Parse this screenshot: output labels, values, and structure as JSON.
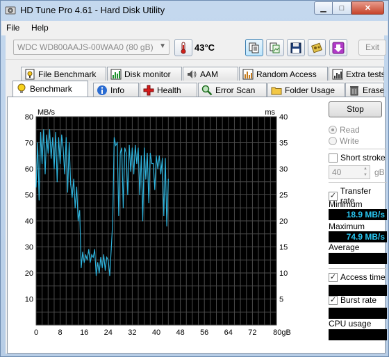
{
  "window": {
    "title": "HD Tune Pro 4.61 - Hard Disk Utility"
  },
  "menu": {
    "file": "File",
    "help": "Help"
  },
  "toolbar": {
    "drive": "WDC WD800AAJS-00WAA0 (80 gB)",
    "temperature": "43°C",
    "exit_label": "Exit"
  },
  "tabs_top": [
    "File Benchmark",
    "Disk monitor",
    "AAM",
    "Random Access",
    "Extra tests"
  ],
  "tabs_bottom": [
    "Benchmark",
    "Info",
    "Health",
    "Error Scan",
    "Folder Usage",
    "Erase"
  ],
  "selected_tab": "Benchmark",
  "controls": {
    "stop_label": "Stop",
    "read_label": "Read",
    "write_label": "Write",
    "read_selected": true,
    "short_stroke_label": "Short stroke",
    "short_stroke_checked": false,
    "short_stroke_value": "40",
    "short_stroke_unit": "gB",
    "transfer_rate_label": "Transfer rate",
    "transfer_rate_checked": true,
    "minimum_label": "Minimum",
    "minimum_value": "18.9 MB/s",
    "maximum_label": "Maximum",
    "maximum_value": "74.9 MB/s",
    "average_label": "Average",
    "average_value": "",
    "access_time_label": "Access time",
    "access_time_checked": true,
    "burst_rate_label": "Burst rate",
    "burst_rate_checked": true,
    "cpu_usage_label": "CPU usage",
    "cpu_usage_value": ""
  },
  "chart_data": {
    "type": "line",
    "ylabel": "MB/s",
    "y2label": "ms",
    "xunit": "gB",
    "xlim": [
      0,
      80
    ],
    "ylim": [
      0,
      80
    ],
    "y2lim": [
      0,
      40
    ],
    "xticks": [
      "0",
      "8",
      "16",
      "24",
      "32",
      "40",
      "48",
      "56",
      "64",
      "72",
      "80gB"
    ],
    "yticks": [
      "80",
      "70",
      "60",
      "50",
      "40",
      "30",
      "20",
      "10"
    ],
    "y2ticks": [
      "40",
      "35",
      "30",
      "25",
      "20",
      "15",
      "10",
      "5"
    ],
    "grid": true,
    "line_color": "#2fb4dd",
    "background": "#000000",
    "series": [
      {
        "values": [
          [
            0.0,
            53
          ],
          [
            0.5,
            70
          ],
          [
            1.0,
            48
          ],
          [
            1.5,
            74
          ],
          [
            2.0,
            62
          ],
          [
            2.5,
            75
          ],
          [
            3.0,
            58
          ],
          [
            3.5,
            73
          ],
          [
            4.0,
            66
          ],
          [
            4.5,
            75
          ],
          [
            5.0,
            64
          ],
          [
            5.5,
            72
          ],
          [
            6.0,
            60
          ],
          [
            6.5,
            74
          ],
          [
            7.0,
            55
          ],
          [
            7.5,
            72
          ],
          [
            8.0,
            62
          ],
          [
            8.5,
            73
          ],
          [
            9.0,
            68
          ],
          [
            9.5,
            58
          ],
          [
            10.0,
            72
          ],
          [
            10.5,
            51
          ],
          [
            11.0,
            70
          ],
          [
            11.5,
            54
          ],
          [
            12.0,
            49
          ],
          [
            12.5,
            56
          ],
          [
            13.0,
            45
          ],
          [
            13.5,
            53
          ],
          [
            14.0,
            40
          ],
          [
            14.5,
            44
          ],
          [
            15.0,
            22
          ],
          [
            15.5,
            28
          ],
          [
            16.0,
            24
          ],
          [
            16.5,
            27
          ],
          [
            17.0,
            25
          ],
          [
            17.5,
            29
          ],
          [
            18.0,
            24
          ],
          [
            18.5,
            27
          ],
          [
            19.0,
            26
          ],
          [
            19.5,
            29
          ],
          [
            20.0,
            19
          ],
          [
            20.5,
            24
          ],
          [
            21.0,
            20
          ],
          [
            21.5,
            26
          ],
          [
            22.0,
            22
          ],
          [
            22.5,
            27
          ],
          [
            23.0,
            21
          ],
          [
            23.5,
            26
          ],
          [
            24.0,
            25
          ],
          [
            24.5,
            19
          ],
          [
            25.0,
            29
          ],
          [
            25.5,
            40
          ],
          [
            26.0,
            72
          ],
          [
            26.5,
            69
          ],
          [
            27.0,
            70
          ],
          [
            27.5,
            42
          ],
          [
            28.0,
            66
          ],
          [
            28.5,
            68
          ],
          [
            29.0,
            45
          ],
          [
            29.5,
            68
          ],
          [
            30.0,
            66
          ],
          [
            30.5,
            50
          ],
          [
            31.0,
            69
          ],
          [
            31.5,
            59
          ],
          [
            32.0,
            68
          ],
          [
            32.5,
            58
          ],
          [
            33.0,
            69
          ],
          [
            33.5,
            62
          ],
          [
            34.0,
            68
          ],
          [
            34.5,
            50
          ],
          [
            35.0,
            65
          ],
          [
            35.5,
            40
          ],
          [
            36.0,
            68
          ],
          [
            36.5,
            56
          ],
          [
            37.0,
            66
          ],
          [
            37.5,
            47
          ],
          [
            38.0,
            66
          ],
          [
            38.5,
            62
          ],
          [
            39.0,
            62
          ],
          [
            39.5,
            52
          ],
          [
            40.0,
            65
          ],
          [
            40.5,
            60
          ],
          [
            41.0,
            65
          ],
          [
            41.5,
            58
          ],
          [
            42.0,
            64
          ],
          [
            42.5,
            42
          ],
          [
            43.0,
            64
          ],
          [
            43.5,
            38
          ],
          [
            44.0,
            56
          ]
        ]
      }
    ]
  }
}
